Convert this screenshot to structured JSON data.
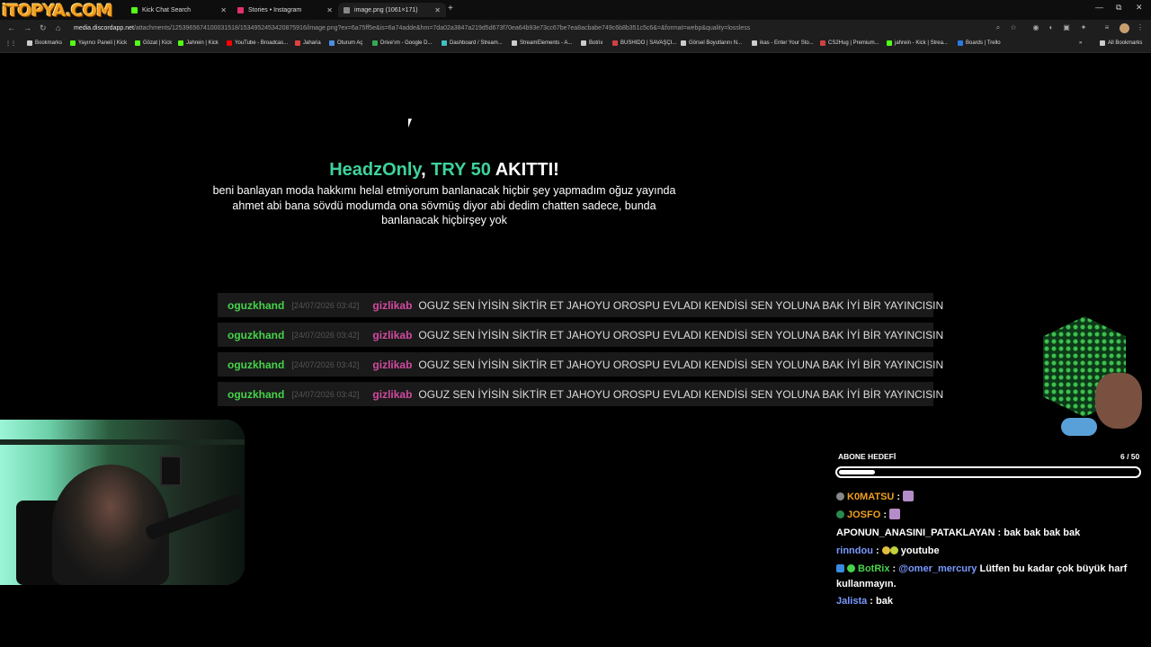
{
  "overlay_logo": "iTOPYA.COM",
  "browser": {
    "tabs": [
      {
        "label": "Kick Chat Search",
        "icon_color": "#53fc18"
      },
      {
        "label": "Stories • Instagram",
        "icon_color": "#e1306c"
      },
      {
        "label": "image.png (1061×171)",
        "icon_color": "#888888"
      }
    ],
    "new_tab": "+",
    "window_controls": [
      "—",
      "⧉",
      "✕"
    ],
    "url_host": "media.discordapp.net",
    "url_path": "/attachments/1253965674100031518/1534952453420875916/image.png?ex=6a75ff5e&is=6a74adde&hm=7da02a3847a219d5d673f70ea64b93e73cc67be7ea8acbabe749c6b8b351c5c6&=&format=webp&quality=lossless",
    "bookmarks": [
      {
        "label": "Bookmarks",
        "color": "#cccccc"
      },
      {
        "label": "Yayıncı Paneli | Kick",
        "color": "#53fc18"
      },
      {
        "label": "Gözat | Kick",
        "color": "#53fc18"
      },
      {
        "label": "Jahrein | Kick",
        "color": "#53fc18"
      },
      {
        "label": "YouTube - Broadcas...",
        "color": "#ff0000"
      },
      {
        "label": "Jaharia",
        "color": "#e04040"
      },
      {
        "label": "Oturum Aç",
        "color": "#4a90e2"
      },
      {
        "label": "Drive'ım - Google D...",
        "color": "#34a853"
      },
      {
        "label": "Dashboard / Stream...",
        "color": "#40c0c0"
      },
      {
        "label": "StreamElements - A...",
        "color": "#cccccc"
      },
      {
        "label": "Botrix",
        "color": "#cccccc"
      },
      {
        "label": "BUSHIDO | SAVAŞÇI...",
        "color": "#d04040"
      },
      {
        "label": "Görsel Boyutlarını N...",
        "color": "#cccccc"
      },
      {
        "label": "ikas - Enter Your Sto...",
        "color": "#cccccc"
      },
      {
        "label": "CS2Hug | Premium...",
        "color": "#d04040"
      },
      {
        "label": "jahrein - Kick | Strea...",
        "color": "#53fc18"
      },
      {
        "label": "Boards | Trello",
        "color": "#2a7ae2"
      },
      {
        "label": "All Bookmarks",
        "color": "#cccccc"
      }
    ]
  },
  "alert": {
    "name": "HeadzOnly",
    "separator": ", ",
    "amount": "TRY 50",
    "action": " AKITTI!",
    "message": "beni banlayan moda hakkımı helal etmiyorum banlanacak hiçbir şey yapmadım oğuz yayında ahmet abi bana sövdü modumda ona sövmüş diyor abi dedim chatten sadece, bunda banlanacak hiçbirşey yok"
  },
  "chat_log": [
    {
      "user": "oguzkhand",
      "timestamp": "[24/07/2026 03:42]",
      "target": "gizlikab",
      "text": "OGUZ SEN İYİSİN SİKTİR ET JAHOYU OROSPU EVLADI KENDİSİ SEN YOLUNA BAK İYİ BİR YAYINCISIN"
    },
    {
      "user": "oguzkhand",
      "timestamp": "[24/07/2026 03:42]",
      "target": "gizlikab",
      "text": "OGUZ SEN İYİSİN SİKTİR ET JAHOYU OROSPU EVLADI KENDİSİ SEN YOLUNA BAK İYİ BİR YAYINCISIN"
    },
    {
      "user": "oguzkhand",
      "timestamp": "[24/07/2026 03:42]",
      "target": "gizlikab",
      "text": "OGUZ SEN İYİSİN SİKTİR ET JAHOYU OROSPU EVLADI KENDİSİ SEN YOLUNA BAK İYİ BİR YAYINCISIN"
    },
    {
      "user": "oguzkhand",
      "timestamp": "[24/07/2026 03:42]",
      "target": "gizlikab",
      "text": "OGUZ SEN İYİSİN SİKTİR ET JAHOYU OROSPU EVLADI KENDİSİ SEN YOLUNA BAK İYİ BİR YAYINCISIN"
    }
  ],
  "sub_goal": {
    "label": "ABONE HEDEFİ",
    "count": "6 / 50",
    "fraction": 0.12
  },
  "stream_chat": [
    {
      "user": "K0MATSU",
      "color": "#f0a020",
      "badge_color": "#888888",
      "text": "",
      "emote": true
    },
    {
      "user": "JOSFO",
      "color": "#f0a020",
      "badge_color": "#2a8a50",
      "text": "",
      "emote": true
    },
    {
      "user": "APONUN_ANASINI_PATAKLAYAN",
      "color": "#ffffff",
      "badge_color": "",
      "text": "bak bak bak bak",
      "emote": false
    },
    {
      "user": "rinndou",
      "color": "#7a9aff",
      "badge_color": "",
      "text": "youtube",
      "emote": true
    },
    {
      "user": "BotRix",
      "color": "#46d34a",
      "badge_color": "#3a8ae0",
      "mention": "@omer_mercury",
      "text": "Lütfen bu kadar çok büyük harf kullanmayın.",
      "emote": false
    },
    {
      "user": "Jalista",
      "color": "#7a9aff",
      "badge_color": "",
      "text": "bak",
      "emote": false
    }
  ],
  "colors": {
    "alert_accent": "#3ed39c",
    "chat_user": "#46d34a",
    "chat_target": "#d24aa0"
  }
}
